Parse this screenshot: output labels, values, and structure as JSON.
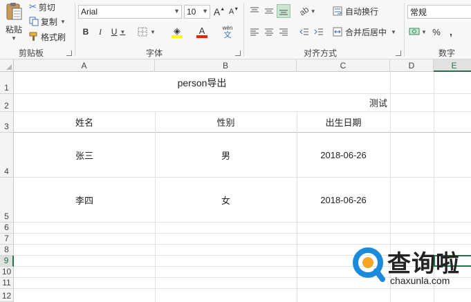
{
  "ribbon": {
    "clipboard": {
      "paste_label": "粘贴",
      "cut_label": "剪切",
      "copy_label": "复制",
      "format_painter_label": "格式刷",
      "group_label": "剪贴板"
    },
    "font": {
      "font_name": "Arial",
      "font_size": "10",
      "bold": "B",
      "italic": "I",
      "underline": "U",
      "grow": "A",
      "shrink": "A",
      "font_color_letter": "A",
      "phonetic_top": "wén",
      "phonetic_bottom": "文",
      "group_label": "字体"
    },
    "alignment": {
      "wrap_text_label": "自动换行",
      "merge_label": "合并后居中",
      "group_label": "对齐方式"
    },
    "number": {
      "format_value": "常规",
      "percent": "%",
      "comma": ",",
      "group_label": "数字"
    },
    "colors": {
      "font_color": "#e32400",
      "fill_color": "#ffff00",
      "accent": "#217346",
      "active_align": "#c9e4d2"
    }
  },
  "sheet": {
    "columns": [
      "A",
      "B",
      "C",
      "D",
      "E"
    ],
    "selected_column": "E",
    "rows": [
      "1",
      "2",
      "3",
      "4",
      "5",
      "6",
      "7",
      "8",
      "9",
      "10",
      "11",
      "12"
    ],
    "selected_row": "9",
    "title": "person导出",
    "subtitle": "测试",
    "headers": [
      "姓名",
      "性别",
      "出生日期"
    ],
    "data": [
      [
        "张三",
        "男",
        "2018-06-26"
      ],
      [
        "李四",
        "女",
        "2018-06-26"
      ]
    ]
  },
  "watermark": {
    "logo_text": "查询啦",
    "url": "chaxunla.com",
    "brand_blue": "#1a8cdb",
    "brand_orange": "#f5a623"
  }
}
